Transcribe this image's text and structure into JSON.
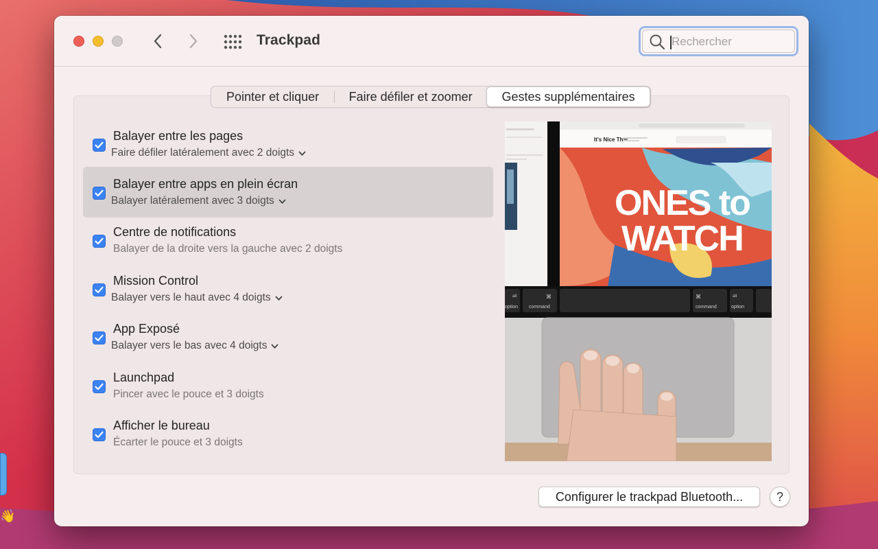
{
  "window": {
    "title": "Trackpad"
  },
  "search": {
    "placeholder": "Rechercher",
    "value": ""
  },
  "tabs": [
    {
      "label": "Pointer et cliquer",
      "selected": false
    },
    {
      "label": "Faire défiler et zoomer",
      "selected": false
    },
    {
      "label": "Gestes supplémentaires",
      "selected": true
    }
  ],
  "gestures": [
    {
      "title": "Balayer entre les pages",
      "subtitle": "Faire défiler latéralement avec 2 doigts",
      "checked": true,
      "has_menu": true,
      "selected": false
    },
    {
      "title": "Balayer entre apps en plein écran",
      "subtitle": "Balayer latéralement avec 3 doigts",
      "checked": true,
      "has_menu": true,
      "selected": true
    },
    {
      "title": "Centre de notifications",
      "subtitle": "Balayer de la droite vers la gauche avec 2 doigts",
      "checked": true,
      "has_menu": false,
      "selected": false
    },
    {
      "title": "Mission Control",
      "subtitle": "Balayer vers le haut avec 4 doigts",
      "checked": true,
      "has_menu": true,
      "selected": false
    },
    {
      "title": "App Exposé",
      "subtitle": "Balayer vers le bas avec 4 doigts",
      "checked": true,
      "has_menu": true,
      "selected": false
    },
    {
      "title": "Launchpad",
      "subtitle": "Pincer avec le pouce et 3 doigts",
      "checked": true,
      "has_menu": false,
      "selected": false
    },
    {
      "title": "Afficher le bureau",
      "subtitle": "Écarter le pouce et 3 doigts",
      "checked": true,
      "has_menu": false,
      "selected": false
    }
  ],
  "preview": {
    "site_name": "It's Nice That",
    "headline_line1": "ONES to",
    "headline_line2": "WATCH",
    "key_alt_left": "alt",
    "key_option_left": "option",
    "key_cmd_symbol": "⌘",
    "key_command": "command",
    "key_alt_right": "alt",
    "key_option_right": "option"
  },
  "buttons": {
    "bluetooth": "Configurer le trackpad Bluetooth...",
    "help": "?"
  },
  "colors": {
    "accent": "#3b82f2",
    "close": "#ee5f58",
    "minimize": "#f5bd2e",
    "zoom_disabled": "#cfc9c9"
  }
}
